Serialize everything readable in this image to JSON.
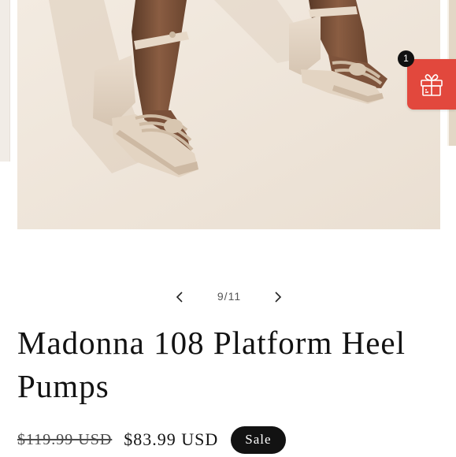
{
  "gallery": {
    "image_alt": "Madonna 108 Platform Heel Pumps",
    "counter": "9/11",
    "prev_icon": "chevron-left-icon",
    "next_icon": "chevron-right-icon"
  },
  "gift_widget": {
    "icon": "gift-icon",
    "badge_count": "1",
    "color": "#e2483d"
  },
  "product": {
    "title": "Madonna 108 Platform Heel Pumps",
    "price_original": "$119.99 USD",
    "price_sale": "$83.99 USD",
    "badge": "Sale"
  }
}
